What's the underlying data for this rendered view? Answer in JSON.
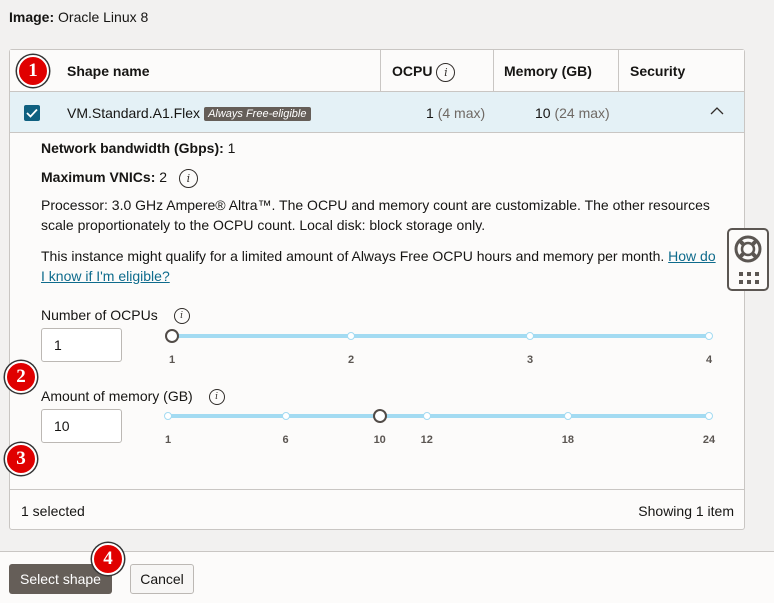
{
  "image_line": {
    "label": "Image:",
    "value": "Oracle Linux 8"
  },
  "table": {
    "headers": {
      "shape_name": "Shape name",
      "ocpu": "OCPU",
      "memory": "Memory (GB)",
      "security": "Security"
    },
    "row": {
      "checked": true,
      "shape_name": "VM.Standard.A1.Flex",
      "badge": "Always Free-eligible",
      "ocpu_value": "1",
      "ocpu_max": "(4 max)",
      "memory_value": "10",
      "memory_max": "(24 max)"
    },
    "details": {
      "network_bandwidth_label": "Network bandwidth (Gbps):",
      "network_bandwidth_value": "1",
      "max_vnics_label": "Maximum VNICs:",
      "max_vnics_value": "2",
      "processor_text": "Processor: 3.0 GHz Ampere® Altra™. The OCPU and memory count are customizable. The other resources scale proportionately to the OCPU count. Local disk: block storage only.",
      "free_text": "This instance might qualify for a limited amount of Always Free OCPU hours and memory per month.",
      "free_link": "How do I know if I'm eligible?"
    },
    "ocpu_field": {
      "label": "Number of OCPUs",
      "value": "1",
      "slider": {
        "min": 1,
        "max": 4,
        "value": 1,
        "ticks": [
          1,
          2,
          3,
          4
        ],
        "labels": [
          "1",
          "2",
          "3",
          "4"
        ]
      }
    },
    "memory_field": {
      "label": "Amount of memory (GB)",
      "value": "10",
      "slider": {
        "min": 1,
        "max": 24,
        "value": 10,
        "ticks": [
          1,
          6,
          12,
          18,
          24
        ],
        "labels": [
          "1",
          "6",
          "10",
          "12",
          "18",
          "24"
        ],
        "label_values": [
          1,
          6,
          10,
          12,
          18,
          24
        ]
      }
    },
    "footer": {
      "selected": "1 selected",
      "showing": "Showing 1 item"
    }
  },
  "buttons": {
    "select": "Select shape",
    "cancel": "Cancel"
  },
  "step_markers": [
    "1",
    "2",
    "3",
    "4"
  ],
  "colors": {
    "accent": "#0f6080",
    "slider": "#a3dbf2",
    "marker": "#e00000",
    "primary_button": "#655e58",
    "link": "#0e6b8c"
  }
}
